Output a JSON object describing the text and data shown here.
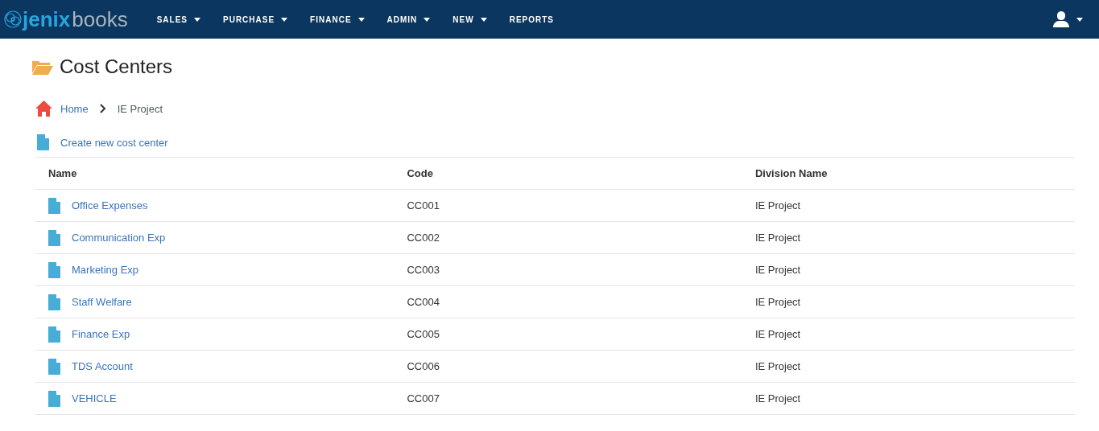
{
  "navbar": {
    "logo": {
      "first": "jenix",
      "second": "books"
    },
    "menu": [
      {
        "label": "SALES",
        "dropdown": true
      },
      {
        "label": "PURCHASE",
        "dropdown": true
      },
      {
        "label": "FINANCE",
        "dropdown": true
      },
      {
        "label": "ADMIN",
        "dropdown": true
      },
      {
        "label": "NEW",
        "dropdown": true
      },
      {
        "label": "REPORTS",
        "dropdown": false
      }
    ]
  },
  "page_title": "Cost Centers",
  "breadcrumb": [
    "Home",
    "IE Project"
  ],
  "create_link": "Create new cost center",
  "table": {
    "columns": [
      "Name",
      "Code",
      "Division Name"
    ],
    "rows": [
      [
        "Office Expenses",
        "CC001",
        "IE Project"
      ],
      [
        "Communication Exp",
        "CC002",
        "IE Project"
      ],
      [
        "Marketing Exp",
        "CC003",
        "IE Project"
      ],
      [
        "Staff Welfare",
        "CC004",
        "IE Project"
      ],
      [
        "Finance Exp",
        "CC005",
        "IE Project"
      ],
      [
        "TDS Account",
        "CC006",
        "IE Project"
      ],
      [
        "VEHICLE",
        "CC007",
        "IE Project"
      ]
    ]
  }
}
